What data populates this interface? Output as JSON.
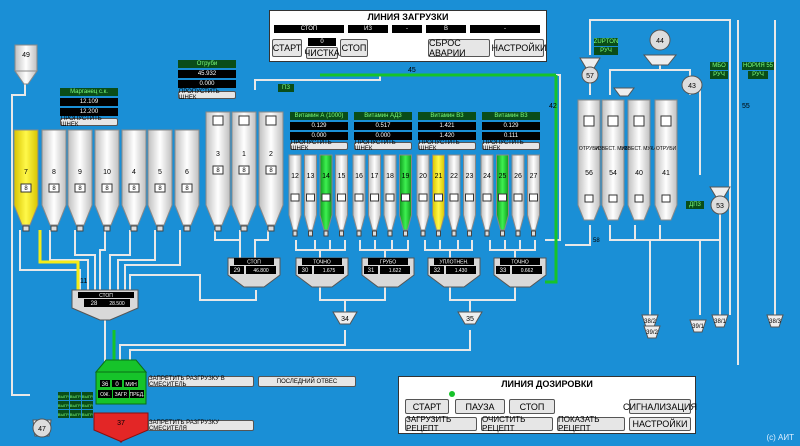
{
  "load_line": {
    "title": "ЛИНИЯ ЗАГРУЗКИ",
    "indicators": [
      "СТОП",
      "ИЗ",
      "-",
      "В",
      "-"
    ],
    "counter": "0",
    "buttons": {
      "start": "СТАРТ",
      "clean": "ЧИСТКА",
      "stop": "СТОП",
      "reset": "СБРОС АВАРИИ",
      "settings": "НАСТРОЙКИ"
    }
  },
  "dose_line": {
    "title": "ЛИНИЯ ДОЗИРОВКИ",
    "buttons": {
      "start": "СТАРТ",
      "pause": "ПАУЗА",
      "stop": "СТОП",
      "alarm": "СИГНАЛИЗАЦИЯ",
      "load_recipe": "ЗАГРУЗИТЬ РЕЦЕПТ",
      "clear_recipe": "ОЧИСТИТЬ РЕЦЕПТ",
      "show_recipe": "ПОКАЗАТЬ РЕЦЕПТ",
      "settings": "НАСТРОЙКИ"
    }
  },
  "copyright": "(c) АИТ",
  "manganese": {
    "name": "Марганец с.к.",
    "v1": "12.109",
    "v2": "12.200",
    "skip": "ПРОПУСТИТЬ ШНЕК"
  },
  "sruba": {
    "name": "Отруби",
    "v1": "45.932",
    "v2": "0.000",
    "skip": "ПРОПУСТИТЬ ШНЕК"
  },
  "vitamins": [
    {
      "name": "Витамин А (1000)",
      "v1": "0.129",
      "v2": "0.000"
    },
    {
      "name": "Витамин АД3",
      "v1": "0.517",
      "v2": "0.000"
    },
    {
      "name": "Витамин В3",
      "v1": "1.421",
      "v2": "1.420"
    },
    {
      "name": "Витамин В3",
      "v1": "0.129",
      "v2": "0.111"
    }
  ],
  "skip_label": "ПРОПУСТИТЬ ШНЕК",
  "bins_main": [
    {
      "n": "7",
      "state": "8"
    },
    {
      "n": "8",
      "state": "8"
    },
    {
      "n": "9",
      "state": "8"
    },
    {
      "n": "10",
      "state": "8"
    },
    {
      "n": "4",
      "state": "8"
    },
    {
      "n": "5",
      "state": "8"
    },
    {
      "n": "6",
      "state": "8"
    },
    {
      "n": "3",
      "state": "8"
    },
    {
      "n": "1",
      "state": "8"
    },
    {
      "n": "2",
      "state": "8"
    }
  ],
  "bins_small": [
    "12",
    "13",
    "14",
    "15",
    "16",
    "17",
    "18",
    "19",
    "20",
    "21",
    "22",
    "23",
    "24",
    "25",
    "26",
    "27"
  ],
  "right_bins": [
    {
      "n": "56",
      "label": "ОТРУБИ"
    },
    {
      "n": "54",
      "label": "ИЗВЕСТ. МУКА"
    },
    {
      "n": "40",
      "label": "ИЗВЕСТ. МУКА"
    },
    {
      "n": "41",
      "label": "ОТРУБИ"
    }
  ],
  "scales": [
    {
      "n": "29",
      "state": "СТОП",
      "val": "46.800"
    },
    {
      "n": "30",
      "state": "ТОЧНО",
      "val": "1.675"
    },
    {
      "n": "31",
      "state": "ГРУБО",
      "val": "1.622"
    },
    {
      "n": "32",
      "state": "УПЛОТНЕН.",
      "val": "1.430"
    },
    {
      "n": "33",
      "state": "ТОЧНО",
      "val": "0.662"
    },
    {
      "n": "28",
      "state": "СТОП",
      "val": "28.500"
    }
  ],
  "mixer": {
    "n": "36",
    "val": "0",
    "unit": "МИН",
    "tags": [
      "ОЖ.",
      "ЗАГР.",
      "ПРЕД."
    ]
  },
  "mixer_buttons": {
    "forbid": "ЗАПРЕТИТЬ РАЗГРУЗКУ В СМЕСИТЕЛЬ",
    "last": "ПОСЛЕДНИЙ ОТВЕС",
    "forbid2": "ЗАПРЕТИТЬ РАЗГРУЗКУ СМЕСИТЕЛЯ"
  },
  "left_small": [
    "ВЫГР.",
    "ВЫГР.",
    "ВЫГР.",
    "ВЫГР.",
    "ВЫГР.",
    "ВЫГР.",
    "ВЫГР.",
    "ВЫГР.",
    "ВЫГР."
  ],
  "labels": {
    "n49": "49",
    "n47": "47",
    "n37": "37",
    "n11": "11",
    "n34": "34",
    "n35": "35",
    "n42": "42",
    "n45": "45",
    "n44": "44",
    "n43": "43",
    "n57": "57",
    "n53": "53",
    "n55": "55",
    "n58": "58",
    "n38_2": "38/2",
    "n39_2": "39/2",
    "n39_1": "39/1",
    "n38_1": "38/1",
    "n38_3": "38/3",
    "zupton": "ZUPTON",
    "ruch": "РУЧ",
    "mbo": "МБО",
    "noria": "НОРИЯ 55",
    "dp3": "ДП3",
    "pz": "ПЗ",
    "ruch2": "РУЧ",
    "ruch3": "РУЧ"
  },
  "colors": {
    "bg": "#1a8fd6",
    "pipe": "#e8e8e8",
    "green": "#16c32a",
    "yellow": "#f4ec16",
    "red": "#e32626"
  }
}
